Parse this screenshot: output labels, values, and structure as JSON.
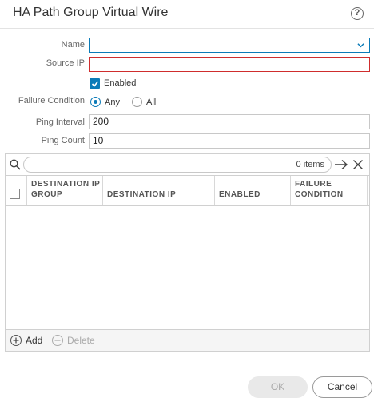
{
  "dialog": {
    "title": "HA Path Group Virtual Wire"
  },
  "form": {
    "name": {
      "label": "Name",
      "value": ""
    },
    "source_ip": {
      "label": "Source IP",
      "value": ""
    },
    "enabled": {
      "label": "Enabled",
      "checked": true
    },
    "failure_condition": {
      "label": "Failure Condition",
      "options": [
        "Any",
        "All"
      ],
      "selected": "Any"
    },
    "ping_interval": {
      "label": "Ping Interval",
      "value": "200"
    },
    "ping_count": {
      "label": "Ping Count",
      "value": "10"
    }
  },
  "grid": {
    "items_count": "0 items",
    "columns": [
      {
        "line1": "DESTINATION IP",
        "line2": "GROUP"
      },
      {
        "line1": "DESTINATION IP",
        "line2": ""
      },
      {
        "line1": "ENABLED",
        "line2": ""
      },
      {
        "line1": "FAILURE",
        "line2": "CONDITION"
      }
    ],
    "rows": [],
    "actions": {
      "add": "Add",
      "delete": "Delete"
    }
  },
  "buttons": {
    "ok": "OK",
    "cancel": "Cancel"
  },
  "colors": {
    "accent": "#0b7bb8",
    "error": "#cf2d2d"
  }
}
